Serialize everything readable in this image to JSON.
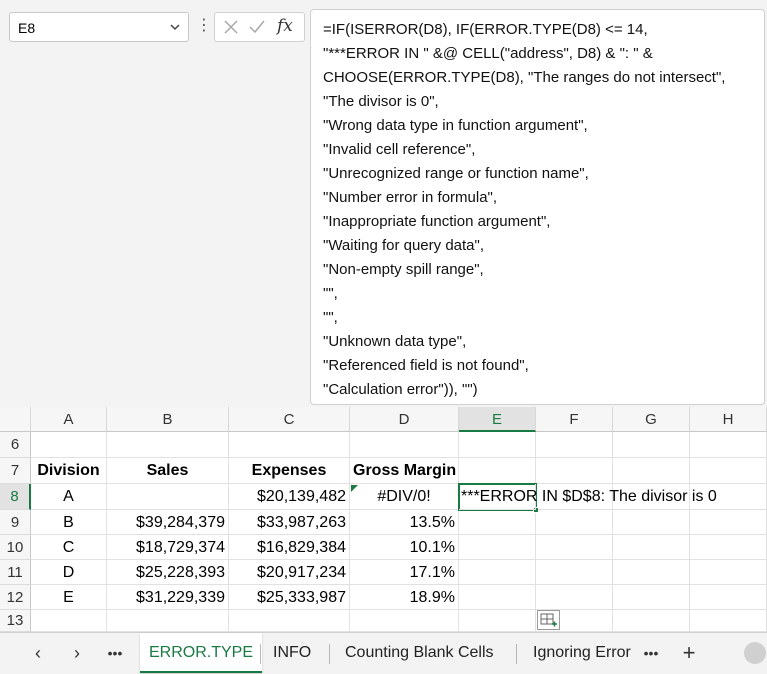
{
  "name_box": {
    "value": "E8"
  },
  "formula_bar": {
    "lines": [
      "=IF(ISERROR(D8), IF(ERROR.TYPE(D8) <= 14,",
      "\"***ERROR IN \" &@ CELL(\"address\", D8) & \": \" &",
      "CHOOSE(ERROR.TYPE(D8), \"The ranges do not intersect\",",
      "\"The divisor is 0\",",
      "\"Wrong data type in function argument\",",
      "\"Invalid cell reference\",",
      "\"Unrecognized range or function name\",",
      "\"Number error in formula\",",
      "\"Inappropriate function argument\",",
      "\"Waiting for query data\",",
      "\"Non-empty spill range\",",
      "\"\",",
      "\"\",",
      "\"Unknown data type\",",
      "\"Referenced field is not found\",",
      "\"Calculation error\")), \"\")"
    ]
  },
  "grid": {
    "columns": [
      "A",
      "B",
      "C",
      "D",
      "E",
      "F",
      "G",
      "H"
    ],
    "rows": [
      {
        "num": "6",
        "cells": [
          "",
          "",
          "",
          "",
          "",
          "",
          "",
          ""
        ]
      },
      {
        "num": "7",
        "cells": [
          "Division",
          "Sales",
          "Expenses",
          "Gross Margin",
          "",
          "",
          "",
          ""
        ]
      },
      {
        "num": "8",
        "cells": [
          "A",
          "",
          "$20,139,482",
          "#DIV/0!",
          "***ERROR IN $D$8: The divisor is 0",
          "",
          "",
          ""
        ]
      },
      {
        "num": "9",
        "cells": [
          "B",
          "$39,284,379",
          "$33,987,263",
          "13.5%",
          "",
          "",
          "",
          ""
        ]
      },
      {
        "num": "10",
        "cells": [
          "C",
          "$18,729,374",
          "$16,829,384",
          "10.1%",
          "",
          "",
          "",
          ""
        ]
      },
      {
        "num": "11",
        "cells": [
          "D",
          "$25,228,393",
          "$20,917,234",
          "17.1%",
          "",
          "",
          "",
          ""
        ]
      },
      {
        "num": "12",
        "cells": [
          "E",
          "$31,229,339",
          "$25,333,987",
          "18.9%",
          "",
          "",
          "",
          ""
        ]
      },
      {
        "num": "13",
        "cells": [
          "",
          "",
          "",
          "",
          "",
          "",
          "",
          ""
        ]
      }
    ],
    "active_cell": "E8"
  },
  "tabs": {
    "items": [
      "ERROR.TYPE",
      "INFO",
      "Counting Blank Cells",
      "Ignoring Error"
    ],
    "active": "ERROR.TYPE",
    "more_label": "•••",
    "add_label": "+"
  },
  "colors": {
    "accent": "#1a7a43"
  }
}
